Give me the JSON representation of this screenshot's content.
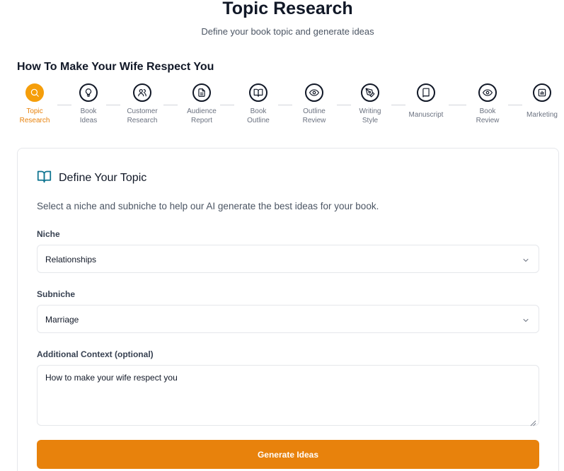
{
  "header": {
    "title": "Topic Research",
    "subtitle": "Define your book topic and generate ideas"
  },
  "book_title": "How To Make Your Wife Respect You",
  "steps": [
    {
      "label": "Topic\nResearch",
      "icon": "search-icon",
      "active": true
    },
    {
      "label": "Book\nIdeas",
      "icon": "lightbulb-icon"
    },
    {
      "label": "Customer\nResearch",
      "icon": "users-icon"
    },
    {
      "label": "Audience\nReport",
      "icon": "document-icon"
    },
    {
      "label": "Book\nOutline",
      "icon": "open-book-icon"
    },
    {
      "label": "Outline\nReview",
      "icon": "eye-icon"
    },
    {
      "label": "Writing\nStyle",
      "icon": "pen-tool-icon"
    },
    {
      "label": "Manuscript",
      "icon": "book-icon"
    },
    {
      "label": "Book\nReview",
      "icon": "eye-icon"
    },
    {
      "label": "Marketing",
      "icon": "bar-chart-icon"
    }
  ],
  "card": {
    "icon": "open-book-icon",
    "title": "Define Your Topic",
    "description": "Select a niche and subniche to help our AI generate the best ideas for your book."
  },
  "form": {
    "niche_label": "Niche",
    "niche_value": "Relationships",
    "subniche_label": "Subniche",
    "subniche_value": "Marriage",
    "context_label": "Additional Context (optional)",
    "context_value": "How to make your wife respect you",
    "generate_label": "Generate Ideas"
  },
  "colors": {
    "accent": "#e8820c",
    "active_step": "#f59e0b",
    "card_icon": "#0e7490"
  }
}
